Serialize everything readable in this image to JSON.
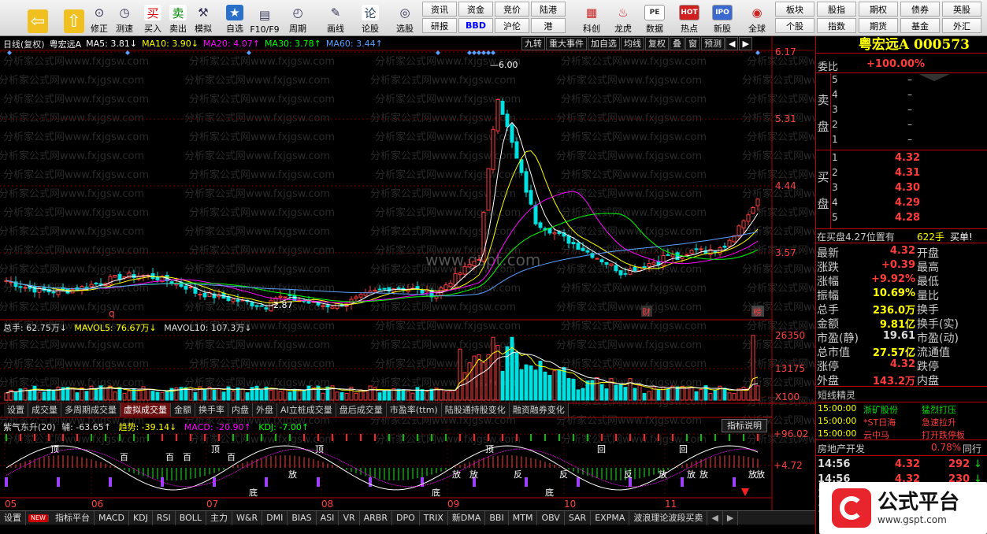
{
  "toolbar": {
    "left_buttons": [
      {
        "id": "back",
        "label": "",
        "icon": "back-arrow-icon"
      },
      {
        "id": "up",
        "label": "",
        "icon": "up-arrow-icon"
      },
      {
        "id": "xiuzheng",
        "label": "修正",
        "icon": "pin-icon"
      },
      {
        "id": "cesu",
        "label": "测速",
        "icon": "clock-icon"
      },
      {
        "id": "buy",
        "label": "买入",
        "icon": "buy-icon",
        "glyph": "买"
      },
      {
        "id": "sell",
        "label": "卖出",
        "icon": "sell-icon",
        "glyph": "卖"
      },
      {
        "id": "simulate",
        "label": "模拟",
        "icon": "hammer-icon"
      },
      {
        "id": "zixuan",
        "label": "自选",
        "icon": "star-icon"
      },
      {
        "id": "f10",
        "label": "F10/F9",
        "icon": "f10-icon"
      },
      {
        "id": "zhouqi",
        "label": "周期",
        "icon": "period-icon"
      },
      {
        "id": "huaxian",
        "label": "画线",
        "icon": "pen-icon"
      },
      {
        "id": "lungu",
        "label": "论股",
        "icon": "discuss-icon",
        "glyph": "论"
      },
      {
        "id": "xuangu",
        "label": "选股",
        "icon": "select-icon"
      }
    ],
    "grid1": [
      [
        "资讯",
        "资金",
        "竞价",
        "陆港"
      ],
      [
        "研报",
        "BBD",
        "沪伦",
        "港"
      ]
    ],
    "mid_buttons": [
      {
        "id": "kechuang",
        "label": "科创",
        "icon": "chart-icon"
      },
      {
        "id": "longhu",
        "label": "龙虎",
        "icon": "dragon-icon"
      },
      {
        "id": "shuju",
        "label": "数据",
        "icon": "pe-icon",
        "glyph": "PE"
      },
      {
        "id": "redian",
        "label": "热点",
        "icon": "hot-icon",
        "glyph": "HOT"
      },
      {
        "id": "xingu",
        "label": "新股",
        "icon": "ipo-icon",
        "glyph": "IPO"
      },
      {
        "id": "quanqiu",
        "label": "全球",
        "icon": "globe-icon"
      }
    ],
    "grid2": [
      [
        "板块",
        "股指",
        "期权",
        "债券",
        "英股"
      ],
      [
        "个股",
        "指数",
        "期货",
        "基金",
        "外汇"
      ]
    ]
  },
  "chart_header": {
    "period": "日线(复权)",
    "name": "粤宏远A",
    "ma5": "MA5: 3.81↓",
    "ma10": "MA10: 3.90↓",
    "ma20": "MA20: 4.07↑",
    "ma30": "MA30: 3.78↑",
    "ma60": "MA60: 3.44↑"
  },
  "header_tabs": [
    "九转",
    "重大事件",
    "加自选",
    "均线",
    "复权",
    "叠",
    "窗",
    "预测"
  ],
  "watermark": "分析家公式网www.fxjgsw.com",
  "gspt": "www.gspt.com",
  "price_axis": [
    "6.17",
    "5.31",
    "4.44",
    "3.57"
  ],
  "high_label": "6.00",
  "low_label": "2.87",
  "markers": {
    "q": "q",
    "cai": "财",
    "bang": "榜"
  },
  "vol_header": {
    "total": "总手: 62.75万↓",
    "mavol5": "MAVOL5: 76.67万↓",
    "mavol10": "MAVOL10: 107.3万↓"
  },
  "vol_axis": [
    "26350",
    "13175",
    "X100"
  ],
  "sub_tabs": [
    "设置",
    "成交量",
    "多周期成交量",
    "虚拟成交量",
    "金额",
    "换手率",
    "内盘",
    "外盘",
    "AI立桩成交量",
    "盘后成交量",
    "市盈率(ttm)",
    "陆股通持股变化",
    "融资融券变化"
  ],
  "ind_header": {
    "name": "紫气东升(20)",
    "fu": "辅: -63.65↑",
    "trend": "趋势: -39.14↓",
    "macd": "MACD: -20.90↑",
    "kdj": "KDJ: -7.00↑"
  },
  "ind_button": "指标说明",
  "ind_axis": [
    "+96.02",
    "+4.72"
  ],
  "ind_labels": {
    "ding": "顶",
    "di": "底",
    "bai": "百",
    "fang": "放",
    "fan": "反",
    "hui": "回"
  },
  "months": [
    "05",
    "06",
    "07",
    "08",
    "09",
    "10",
    "11"
  ],
  "bottom_tabs": [
    "设置",
    "指标平台",
    "MACD",
    "KDJ",
    "RSI",
    "BOLL",
    "主力",
    "W&R",
    "DMI",
    "BIAS",
    "ASI",
    "VR",
    "ARBR",
    "DPO",
    "TRIX",
    "新DMA",
    "BBI",
    "MTM",
    "OBV",
    "SAR",
    "EXPMA",
    "波浪理论波段买卖"
  ],
  "bottom_new": "NEW",
  "quote": {
    "title": "粤宏远A",
    "code": "000573",
    "weibi_label": "委比",
    "weibi": "+100.00%",
    "sell_label": [
      "卖",
      "盘"
    ],
    "buy_label": [
      "买",
      "盘"
    ],
    "sell": [
      {
        "n": "5",
        "p": "–"
      },
      {
        "n": "4",
        "p": "–"
      },
      {
        "n": "3",
        "p": "–"
      },
      {
        "n": "2",
        "p": "–"
      },
      {
        "n": "1",
        "p": "–"
      }
    ],
    "buy": [
      {
        "n": "1",
        "p": "4.32"
      },
      {
        "n": "2",
        "p": "4.31"
      },
      {
        "n": "3",
        "p": "4.30"
      },
      {
        "n": "4",
        "p": "4.29"
      },
      {
        "n": "5",
        "p": "4.28"
      }
    ],
    "buy_pos": "在买盘4.27位置有",
    "buy_pos_vol": "622手",
    "buy_pos_tag": "买单!",
    "rows": [
      {
        "l": "最新",
        "v": "4.32",
        "c": "red",
        "l2": "开盘",
        "v2": ""
      },
      {
        "l": "涨跌",
        "v": "+0.39",
        "c": "red",
        "l2": "最高",
        "v2": ""
      },
      {
        "l": "涨幅",
        "v": "+9.92%",
        "c": "red",
        "l2": "最低",
        "v2": ""
      },
      {
        "l": "振幅",
        "v": "10.69%",
        "c": "yel",
        "l2": "量比",
        "v2": ""
      },
      {
        "l": "总手",
        "v": "236.0万",
        "c": "yel",
        "l2": "换手",
        "v2": ""
      },
      {
        "l": "金额",
        "v": "9.81亿",
        "c": "yel",
        "l2": "换手(实)",
        "v2": ""
      },
      {
        "l": "市盈(静)",
        "v": "19.61",
        "c": "lbl",
        "l2": "市盈(动)",
        "v2": ""
      },
      {
        "l": "总市值",
        "v": "27.57亿",
        "c": "yel",
        "l2": "流通值",
        "v2": ""
      },
      {
        "l": "涨停",
        "v": "4.32",
        "c": "red",
        "l2": "跌停",
        "v2": ""
      },
      {
        "l": "外盘",
        "v": "143.2万",
        "c": "red",
        "l2": "内盘",
        "v2": ""
      }
    ],
    "news_title": "短线精灵",
    "news": [
      {
        "t": "15:00:00",
        "s": "浙矿股份",
        "e": "猛烈打压"
      },
      {
        "t": "15:00:00",
        "s": "*ST日海",
        "e": "急速拉升"
      },
      {
        "t": "15:00:00",
        "s": "云中马",
        "e": "打开跌停板"
      }
    ],
    "sector": "房地产开发",
    "sector_pct": "0.78%",
    "sector_more": "同行",
    "ticks": [
      {
        "t": "14:56",
        "p": "4.32",
        "v": "292"
      },
      {
        "t": "14:56",
        "p": "4.32",
        "v": "230"
      },
      {
        "t": "14:56",
        "p": "",
        "v": ""
      },
      {
        "t": "14:56",
        "p": "",
        "v": ""
      }
    ]
  },
  "logo": {
    "text": "公式平台",
    "url": "www.gspt.com"
  },
  "colors": {
    "up": "#ff3c3c",
    "down": "#00e0e0",
    "ma5": "#ffffff",
    "ma10": "#ffff00",
    "ma20": "#ff00ff",
    "ma30": "#00ff00",
    "ma60": "#5aa0ff"
  }
}
